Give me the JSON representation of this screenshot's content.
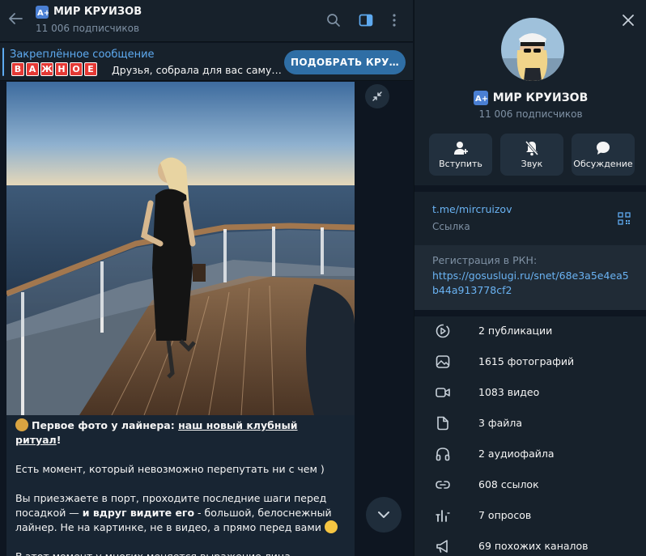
{
  "chat": {
    "title": "МИР КРУИЗОВ",
    "subscribers": "11 006 подписчиков",
    "logo_text": "A+"
  },
  "pinned": {
    "label": "Закреплённое сообщение",
    "tag_letters": [
      "В",
      "А",
      "Ж",
      "Н",
      "О",
      "Е"
    ],
    "text": "Друзья, собрала для вас саму…",
    "button": "ПОДОБРАТЬ КРУ…"
  },
  "message": {
    "emoji_camera": "📸",
    "line1_bold": "Первое фото у лайнера: ",
    "line1_underlined": "наш новый клубный ритуал",
    "line1_end": "!",
    "p2": "Есть момент, который невозможно перепутать ни с чем )",
    "p3_a": "Вы приезжаете в порт, проходите последние шаги перед посадкой — ",
    "p3_bold": "и вдруг видите его",
    "p3_b": " - большой, белоснежный лайнер. Не на картинке, не в видео, а прямо перед вами",
    "p4": "В этот момент у многих меняется выражение лица — тревога"
  },
  "info": {
    "name": "МИР КРУИЗОВ",
    "subscribers": "11 006 подписчиков",
    "actions": {
      "join": "Вступить",
      "sound": "Звук",
      "discussion": "Обсуждение"
    },
    "link": "t.me/mircruizov",
    "link_label": "Ссылка",
    "rkn_label": "Регистрация в РКН:",
    "rkn_url": "https://gosuslugi.ru/snet/68e3a5e4ea5b44a913778cf2",
    "media": [
      {
        "icon": "posts-icon",
        "label": "2 публикации"
      },
      {
        "icon": "photo-icon",
        "label": "1615 фотографий"
      },
      {
        "icon": "video-icon",
        "label": "1083 видео"
      },
      {
        "icon": "file-icon",
        "label": "3 файла"
      },
      {
        "icon": "headphones-icon",
        "label": "2 аудиофайла"
      },
      {
        "icon": "link-icon",
        "label": "608 ссылок"
      },
      {
        "icon": "poll-icon",
        "label": "7 опросов"
      },
      {
        "icon": "megaphone-icon",
        "label": "69 похожих каналов"
      }
    ]
  },
  "colors": {
    "accent": "#5eaaf0",
    "link": "#6ab3f3",
    "panel": "#17212b",
    "background": "#0e1621",
    "button": "#2f6ea5",
    "tag_red": "#e53935"
  }
}
